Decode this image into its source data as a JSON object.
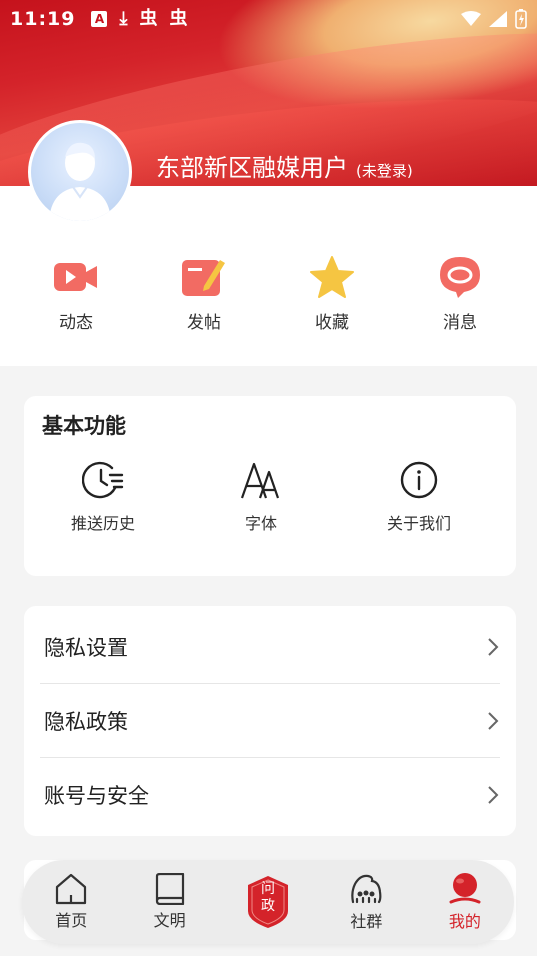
{
  "status_bar": {
    "time": "11:19"
  },
  "profile": {
    "name": "东部新区融媒用户",
    "login_state": "(未登录)"
  },
  "quick_actions": [
    {
      "label": "动态",
      "icon": "video-icon"
    },
    {
      "label": "发帖",
      "icon": "post-icon"
    },
    {
      "label": "收藏",
      "icon": "star-icon"
    },
    {
      "label": "消息",
      "icon": "message-icon"
    }
  ],
  "basic_functions": {
    "title": "基本功能",
    "items": [
      {
        "label": "推送历史",
        "icon": "history-icon"
      },
      {
        "label": "字体",
        "icon": "font-icon"
      },
      {
        "label": "关于我们",
        "icon": "info-icon"
      }
    ]
  },
  "settings": [
    {
      "label": "隐私设置"
    },
    {
      "label": "隐私政策"
    },
    {
      "label": "账号与安全"
    }
  ],
  "bottom_nav": [
    {
      "label": "首页",
      "icon": "home-icon"
    },
    {
      "label": "文明",
      "icon": "book-icon"
    },
    {
      "label": "问政",
      "icon": "wenzheng-icon",
      "badge": "问\n政"
    },
    {
      "label": "社群",
      "icon": "community-icon"
    },
    {
      "label": "我的",
      "icon": "profile-icon",
      "active": true
    }
  ],
  "colors": {
    "brand_red": "#d4232a",
    "page_bg": "#f4f4f4"
  }
}
